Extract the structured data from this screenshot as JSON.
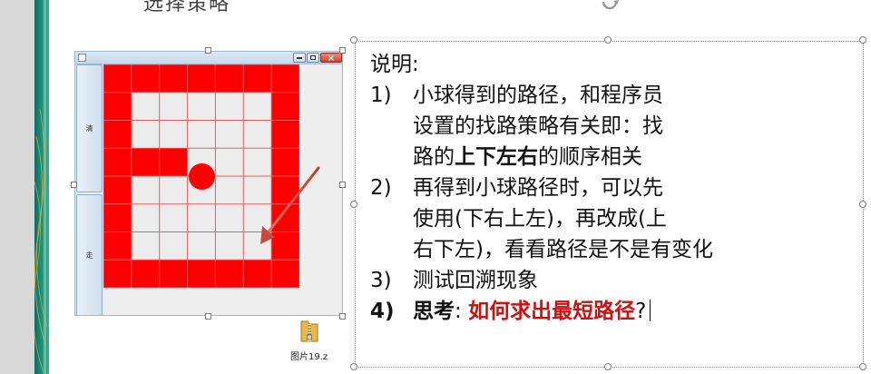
{
  "slide": {
    "top_fragment": "选择策略",
    "accent_color": "#1a8f78"
  },
  "app_window": {
    "buttons": {
      "clear_label": "清",
      "go_label": "走"
    },
    "maze": {
      "rows": 8,
      "cols": 7,
      "wall_color": "#ff0000",
      "open_color": "#ececec",
      "grid": [
        [
          1,
          1,
          1,
          1,
          1,
          1,
          1
        ],
        [
          1,
          0,
          0,
          0,
          0,
          0,
          1
        ],
        [
          1,
          0,
          0,
          0,
          0,
          0,
          1
        ],
        [
          1,
          1,
          1,
          0,
          0,
          0,
          1
        ],
        [
          1,
          0,
          0,
          0,
          0,
          0,
          1
        ],
        [
          1,
          0,
          0,
          0,
          0,
          0,
          1
        ],
        [
          1,
          0,
          0,
          0,
          0,
          0,
          1
        ],
        [
          1,
          1,
          1,
          1,
          1,
          1,
          1
        ]
      ],
      "ball": {
        "row": 4,
        "col": 3
      }
    }
  },
  "attachment": {
    "file_name": "图片19.z",
    "icon": "zip-folder-icon"
  },
  "notes": {
    "heading": "说明:",
    "items": [
      {
        "num": "1)",
        "lines": [
          "小球得到的路径，和程序员",
          "设置的找路策略有关即：找"
        ],
        "last_prefix": "路的",
        "last_emph": "上下左右",
        "last_suffix": "的顺序相关"
      },
      {
        "num": "2)",
        "lines": [
          "再得到小球路径时，可以先",
          "使用(下右上左)，再改成(上",
          "右下左)，看看路径是不是有变化"
        ]
      },
      {
        "num": "3)",
        "lines": [
          "测试回溯现象"
        ]
      },
      {
        "num": "4)",
        "prefix": "思考",
        "colon": ": ",
        "highlight": "如何求出最短路径",
        "suffix": "?"
      }
    ]
  }
}
